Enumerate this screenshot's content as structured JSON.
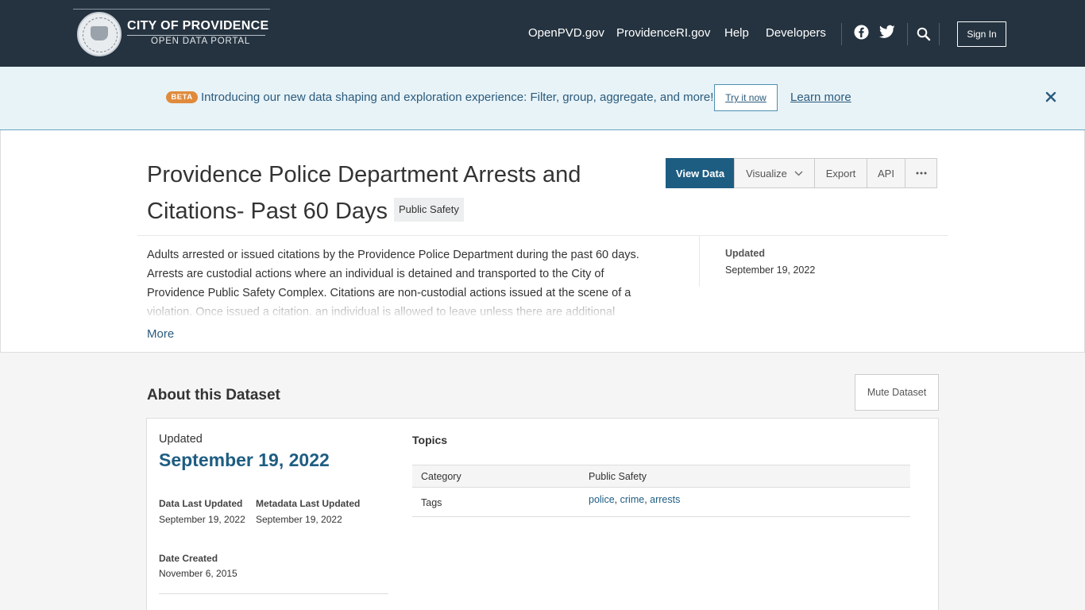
{
  "header": {
    "logo_title": "CITY OF PROVIDENCE",
    "logo_subtitle": "OPEN DATA PORTAL",
    "nav": [
      "OpenPVD.gov",
      "ProvidenceRI.gov",
      "Help",
      "Developers"
    ],
    "icons": [
      "facebook-icon",
      "twitter-icon",
      "search-icon"
    ],
    "sign_in": "Sign In"
  },
  "banner": {
    "badge": "BETA",
    "text": "Introducing our new data shaping and exploration experience: Filter, group, aggregate, and more!",
    "try_button": "Try it now",
    "learn_more": "Learn more"
  },
  "dataset": {
    "title": "Providence Police Department Arrests and Citations- Past 60 Days",
    "category_chip": "Public Safety",
    "actions": {
      "view_data": "View Data",
      "visualize": "Visualize",
      "export": "Export",
      "api": "API"
    },
    "description": "Adults arrested or issued citations by the Providence Police Department during the past 60 days. Arrests are custodial actions where an individual is detained and transported to the City of Providence Public Safety Complex. Citations are non-custodial actions issued at the scene of a violation. Once issued a citation, an individual is allowed to leave unless there are additional",
    "more": "More",
    "side_updated_label": "Updated",
    "side_updated_value": "September 19, 2022"
  },
  "about": {
    "title": "About this Dataset",
    "mute_button": "Mute Dataset",
    "updated_label": "Updated",
    "updated_date": "September 19, 2022",
    "data_last_updated_label": "Data Last Updated",
    "data_last_updated_value": "September 19, 2022",
    "metadata_last_updated_label": "Metadata Last Updated",
    "metadata_last_updated_value": "September 19, 2022",
    "date_created_label": "Date Created",
    "date_created_value": "November 6, 2015",
    "topics": {
      "title": "Topics",
      "category_label": "Category",
      "category_value": "Public Safety",
      "tags_label": "Tags",
      "tags": [
        "police",
        "crime",
        "arrests"
      ]
    }
  },
  "colors": {
    "header_bg": "#253340",
    "primary": "#1e5d82",
    "banner_bg": "#e8f3f8",
    "beta_badge": "#e08b3c"
  }
}
